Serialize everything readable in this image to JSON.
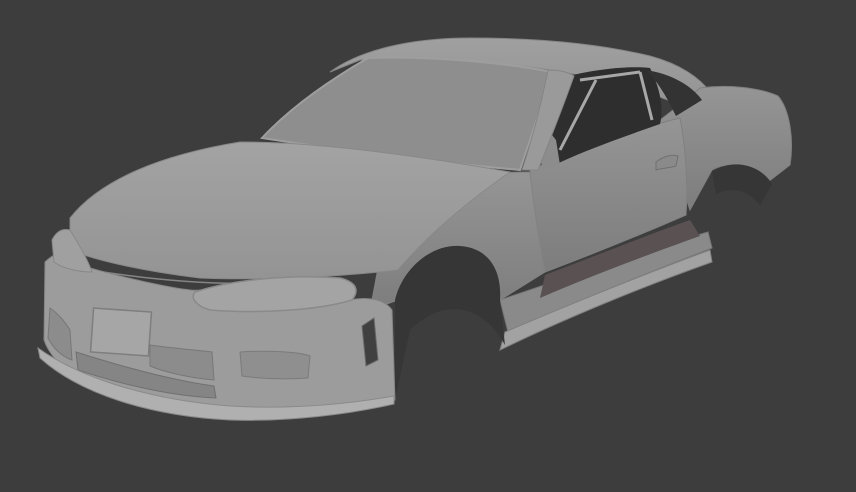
{
  "viewport": {
    "background_color": "#3d3d3d",
    "model": {
      "body_color": "#9a9a9a",
      "body_shadow_color": "#7a7a7a",
      "body_highlight_color": "#acacac",
      "glass_color": "#8e8e8e",
      "interior_color": "#2e2e2e",
      "wheel_well_color": "#363636"
    }
  }
}
